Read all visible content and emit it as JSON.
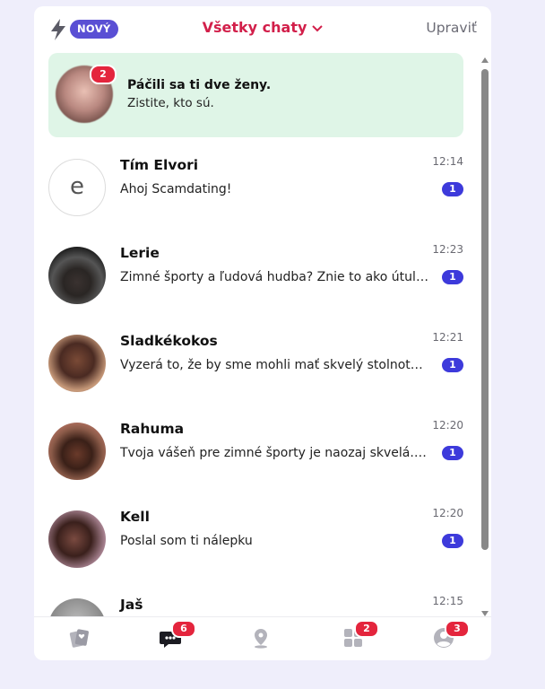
{
  "header": {
    "badge_label": "NOVÝ",
    "title": "Všetky chaty",
    "edit_label": "Upraviť"
  },
  "promo": {
    "count": "2",
    "title": "Páčili sa ti dve ženy.",
    "subtitle": "Zistite, kto sú."
  },
  "chats": [
    {
      "name": "Tím Elvori",
      "message": "Ahoj Scamdating!",
      "time": "12:14",
      "unread": "1",
      "avatar_letter": "e"
    },
    {
      "name": "Lerie",
      "message": "Zimné športy a ľudová hudba? Znie to ako útulné",
      "time": "12:23",
      "unread": "1"
    },
    {
      "name": "Sladkékokos",
      "message": "Vyzerá to, že by sme mohli mať skvelý stolnotenisový",
      "time": "12:21",
      "unread": "1"
    },
    {
      "name": "Rahuma",
      "message": "Tvoja vášeň pre zimné športy je naozaj skvelá. Kto",
      "time": "12:20",
      "unread": "1"
    },
    {
      "name": "Kell",
      "message": "Poslal som ti nálepku",
      "time": "12:20",
      "unread": "1"
    },
    {
      "name": "Jaš",
      "message": "",
      "time": "12:15",
      "unread": ""
    }
  ],
  "nav": {
    "cards_icon": "cards-icon",
    "chat_icon": "chat-icon",
    "chat_badge": "6",
    "location_icon": "location-pin-icon",
    "apps_icon": "grid-icon",
    "apps_badge": "2",
    "profile_icon": "profile-icon",
    "profile_badge": "3"
  },
  "colors": {
    "accent": "#d21f4a",
    "badge_purple": "#5a4fd4",
    "unread_blue": "#3d3adb",
    "promo_bg": "#dff5e7",
    "notification_red": "#e4253d",
    "page_bg": "#efeefb"
  }
}
